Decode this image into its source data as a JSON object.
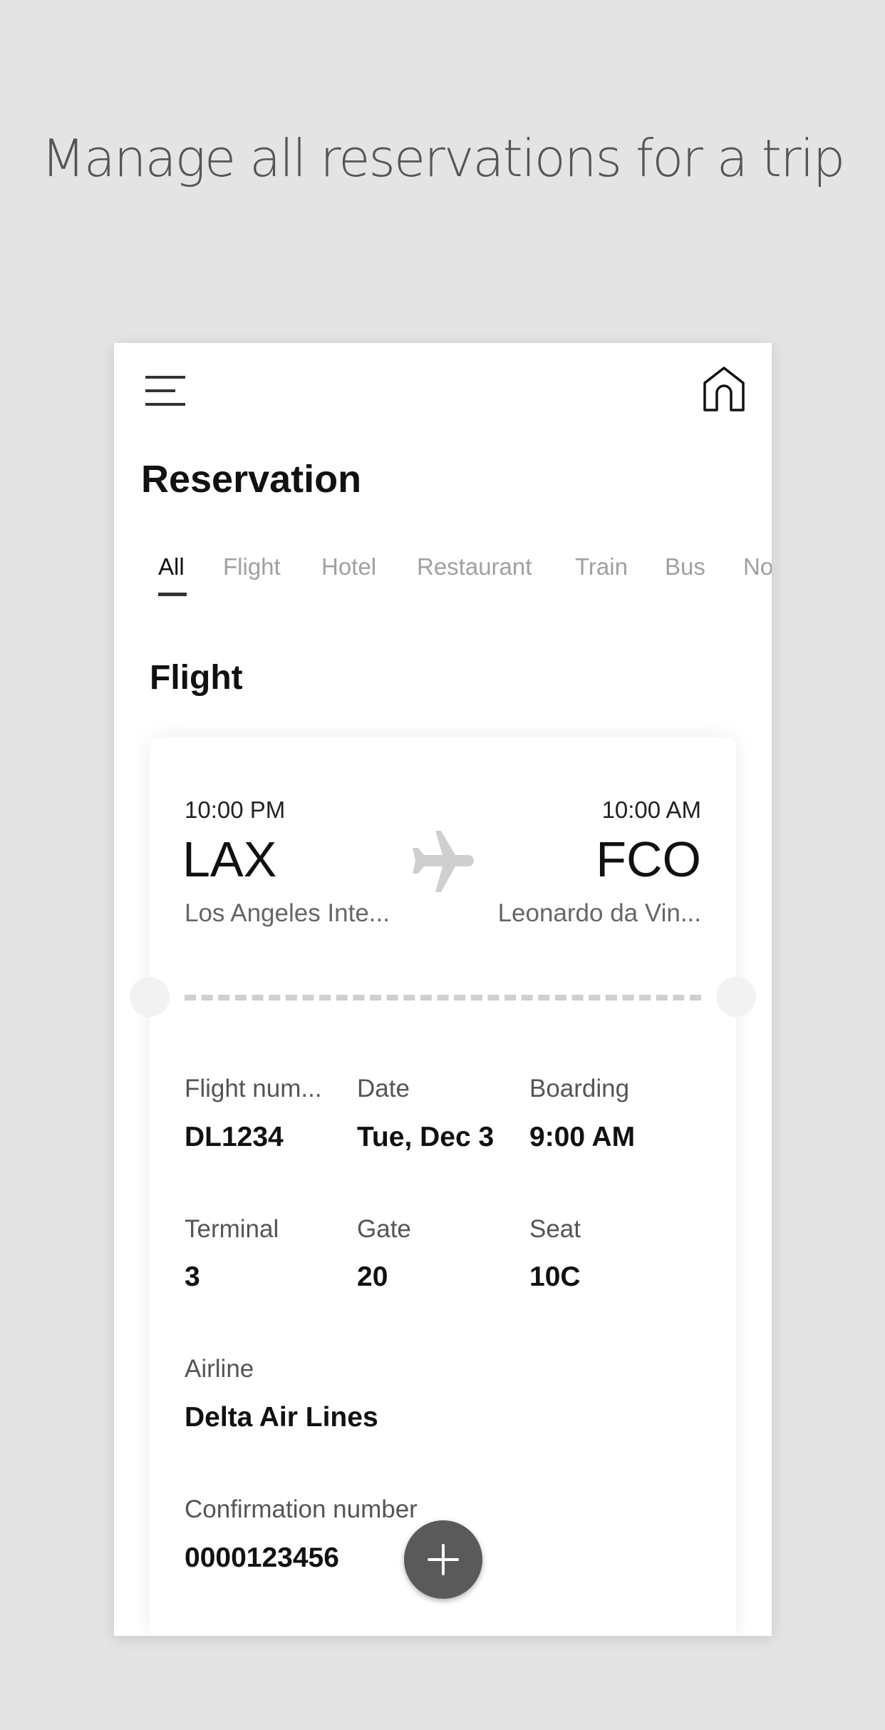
{
  "headline": "Manage all reservations for a trip",
  "header": {
    "menu_icon": "hamburger-icon",
    "home_icon": "home-icon",
    "title": "Reservation"
  },
  "tabs": [
    {
      "label": "All",
      "active": true
    },
    {
      "label": "Flight"
    },
    {
      "label": "Hotel"
    },
    {
      "label": "Restaurant"
    },
    {
      "label": "Train"
    },
    {
      "label": "Bus"
    },
    {
      "label": "No"
    }
  ],
  "section_title": "Flight",
  "flight": {
    "depart_time": "10:00 PM",
    "depart_code": "LAX",
    "depart_name": "Los Angeles Inte...",
    "arrive_time": "10:00 AM",
    "arrive_code": "FCO",
    "arrive_name": "Leonardo da Vin...",
    "details": [
      {
        "label": "Flight num...",
        "value": "DL1234"
      },
      {
        "label": "Date",
        "value": "Tue, Dec 3"
      },
      {
        "label": "Boarding",
        "value": "9:00 AM"
      },
      {
        "label": "Terminal",
        "value": "3"
      },
      {
        "label": "Gate",
        "value": "20"
      },
      {
        "label": "Seat",
        "value": "10C"
      },
      {
        "label": "Airline",
        "value": "Delta Air Lines"
      },
      {
        "label": "Confirmation number",
        "value": "0000123456"
      }
    ]
  },
  "fab_icon": "plus-icon"
}
